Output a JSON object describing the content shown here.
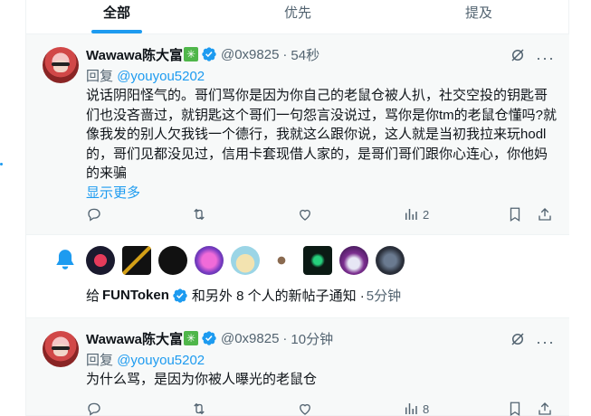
{
  "tabs": [
    "全部",
    "优先",
    "提及"
  ],
  "tweets": [
    {
      "name": "Wawawa陈大富",
      "emoji": "✳️",
      "handle": "@0x9825",
      "sep": "·",
      "time": "54秒",
      "reply_prefix": "回复",
      "reply_to": "@youyou5202",
      "text": "说话阴阳怪气的。哥们骂你是因为你自己的老鼠仓被人扒，社交空投的钥匙哥们也没吝啬过，就钥匙这个哥们一句怨言没说过，骂你是你tm的老鼠仓懂吗?就像我发的别人欠我钱一个德行，我就这么跟你说，这人就是当初我拉来玩hodl的，哥们见都没见过，信用卡套现借人家的，是哥们哥们跟你心连心，你他妈的来骗",
      "show_more": "显示更多",
      "views": "2"
    },
    {
      "name": "Wawawa陈大富",
      "emoji": "✳️",
      "handle": "@0x9825",
      "sep": "·",
      "time": "10分钟",
      "reply_prefix": "回复",
      "reply_to": "@youyou5202",
      "text": "为什么骂，是因为你被人曝光的老鼠仓",
      "views": "8"
    }
  ],
  "notification": {
    "prefix": "给",
    "account": "FUNToken",
    "suffix": "和另外 8 个人的新帖子通知 ·",
    "time": "5分钟"
  },
  "colors": {
    "accent": "#1d9bf0",
    "muted": "#536471",
    "text": "#0f1419"
  },
  "icons": [
    "reply-icon",
    "retweet-icon",
    "like-icon",
    "views-icon",
    "bookmark-icon",
    "share-icon",
    "grok-icon",
    "more-icon",
    "bell-icon",
    "verified-icon"
  ]
}
